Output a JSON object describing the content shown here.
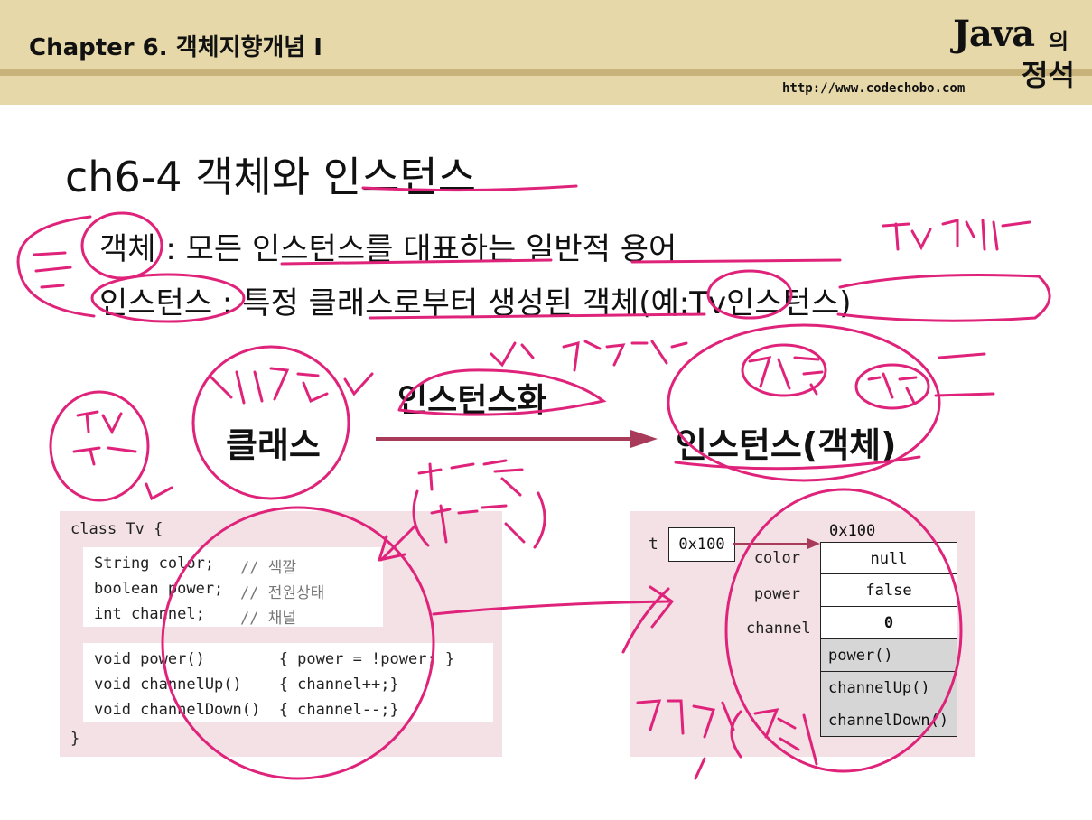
{
  "header": {
    "chapter": "Chapter 6. 객체지향개념 I",
    "logo_java": "Java",
    "logo_ui": "의",
    "logo_jeong": "정석",
    "url": "http://www.codechobo.com"
  },
  "slide": {
    "title": "ch6-4 객체와 인스턴스",
    "def1": "객체 : 모든 인스턴스를 대표하는 일반적 용어",
    "def2": "인스턴스 : 특정 클래스로부터 생성된 객체(예:Tv인스턴스)",
    "class_word": "클래스",
    "instantiate_word": "인스턴스화",
    "instance_word": "인스턴스(객체)"
  },
  "code": {
    "lines": [
      "class Tv {",
      "String color;",
      "boolean power;",
      "int channel;",
      "void power()        { power = !power; }",
      "void channelUp()    { channel++;}",
      "void channelDown()  { channel--;}",
      "}"
    ],
    "comments": [
      "// 색깔",
      "// 전원상태",
      "// 채널"
    ]
  },
  "memory": {
    "ref_name": "t",
    "ref_value": "0x100",
    "address": "0x100",
    "fields": [
      {
        "name": "color",
        "value": "null"
      },
      {
        "name": "power",
        "value": "false"
      },
      {
        "name": "channel",
        "value": "0"
      }
    ],
    "methods": [
      "power()",
      "channelUp()",
      "channelDown()"
    ]
  },
  "colors": {
    "header_bg": "#e6d8a8",
    "box_bg": "#f3e1e6",
    "ink": "#e0237a"
  }
}
